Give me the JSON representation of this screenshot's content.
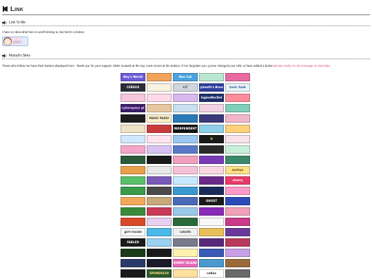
{
  "page": {
    "title_initial": "L",
    "title_rest": "INK"
  },
  "link_section": {
    "heading": "Link To Me",
    "intro": "I have no idea what here is worth linking to, but here's a button.",
    "button_text": "callus"
  },
  "mutuals_section": {
    "heading": "Mutual's Sites",
    "intro": "Those who follow me have their buttons displayed here - thank you for your support. Older mutuals at the top, most recent at the bottom. If I've forgotten you, you've changed your URL or have added a button ",
    "notify_link": "please notify me via message on Neocities."
  },
  "colors": {
    "link": "#e4477f",
    "rule": "#777777"
  },
  "buttons": [
    {
      "label": "Bey's World",
      "bg": "#6b5bd6",
      "fg": "#ffffff"
    },
    {
      "label": "",
      "bg": "#f2a35b",
      "fg": "#ffffff"
    },
    {
      "label": "Neo Cat",
      "bg": "#4aa3df",
      "fg": "#ffffff"
    },
    {
      "label": "",
      "bg": "#b9e8d0",
      "fg": "#3a7a5a"
    },
    {
      "label": "",
      "bg": "#e86aa0",
      "fg": "#ffffff"
    },
    {
      "label": "CEREUS",
      "bg": "#2d2d3a",
      "fg": "#ffffff"
    },
    {
      "label": "",
      "bg": "#f8f2e0",
      "fg": "#555555"
    },
    {
      "label": "LIT",
      "bg": "#cfd6dc",
      "fg": "#404a55"
    },
    {
      "label": "Sylmoth's Brook",
      "bg": "#2e3f9e",
      "fg": "#ffffff"
    },
    {
      "label": "tonic funk",
      "bg": "#e7f3f8",
      "fg": "#2a5a8a"
    },
    {
      "label": "",
      "bg": "#f6c6dc",
      "fg": "#a03a6a"
    },
    {
      "label": "",
      "bg": "#ffd9e8",
      "fg": "#b04a7a"
    },
    {
      "label": "",
      "bg": "#d9b8f0",
      "fg": "#6a3a9a"
    },
    {
      "label": "loginsRecDel",
      "bg": "#1f2f6a",
      "fg": "#ffffff"
    },
    {
      "label": "",
      "bg": "#ff8c9a",
      "fg": "#ffffff"
    },
    {
      "label": "cyberspace gf",
      "bg": "#3a1f6a",
      "fg": "#f3c6ff"
    },
    {
      "label": "",
      "bg": "#e8c7a0",
      "fg": "#5a3a20"
    },
    {
      "label": "",
      "bg": "#c8e0f0",
      "fg": "#2a4a6a"
    },
    {
      "label": "",
      "bg": "#f3d2e4",
      "fg": "#8a3a6a"
    },
    {
      "label": "",
      "bg": "#7fcfb9",
      "fg": "#ffffff"
    },
    {
      "label": "",
      "bg": "#1d1d1d",
      "fg": "#ff4a8a"
    },
    {
      "label": "PADEI PADEI",
      "bg": "#fff1c9",
      "fg": "#444444"
    },
    {
      "label": "",
      "bg": "#2a7ab8",
      "fg": "#ffffff"
    },
    {
      "label": "",
      "bg": "#3a3a7a",
      "fg": "#d0d0ff"
    },
    {
      "label": "",
      "bg": "#f1b7c9",
      "fg": "#7a2a4a"
    },
    {
      "label": "",
      "bg": "#efe3c6",
      "fg": "#5a4a2a"
    },
    {
      "label": "",
      "bg": "#c93b3b",
      "fg": "#ffffff"
    },
    {
      "label": "INDEPENDENT",
      "bg": "#111111",
      "fg": "#ffffff"
    },
    {
      "label": "",
      "bg": "#8fd0e8",
      "fg": "#2a4a5a"
    },
    {
      "label": "",
      "bg": "#ffd27a",
      "fg": "#6a4a1a"
    },
    {
      "label": "",
      "bg": "#d0e8ff",
      "fg": "#2a4a7a"
    },
    {
      "label": "",
      "bg": "#ffe4f0",
      "fg": "#a04a7a"
    },
    {
      "label": "",
      "bg": "#9ac8f0",
      "fg": "#1a3a5a"
    },
    {
      "label": "H",
      "bg": "#1a1a1a",
      "fg": "#f2e24a"
    },
    {
      "label": "",
      "bg": "#f8e1e8",
      "fg": "#8a3a5a"
    },
    {
      "label": "",
      "bg": "#f3a6c8",
      "fg": "#ffffff"
    },
    {
      "label": "",
      "bg": "#d7c2f4",
      "fg": "#5a3a8a"
    },
    {
      "label": "",
      "bg": "#5a7ac8",
      "fg": "#ffffff"
    },
    {
      "label": "",
      "bg": "#2a2a2a",
      "fg": "#ffffff"
    },
    {
      "label": "",
      "bg": "#c8f0d8",
      "fg": "#2a6a4a"
    },
    {
      "label": "",
      "bg": "#2a5a3a",
      "fg": "#c8ffd0"
    },
    {
      "label": "",
      "bg": "#1a1a1a",
      "fg": "#e04a4a"
    },
    {
      "label": "",
      "bg": "#f2a0c0",
      "fg": "#ffffff"
    },
    {
      "label": "",
      "bg": "#7a3ab8",
      "fg": "#ffffff"
    },
    {
      "label": "",
      "bg": "#3a8a6a",
      "fg": "#ffffff"
    },
    {
      "label": "",
      "bg": "#e8a04a",
      "fg": "#ffffff"
    },
    {
      "label": "",
      "bg": "#e8e8e8",
      "fg": "#3a3a3a"
    },
    {
      "label": "",
      "bg": "#f6c0d8",
      "fg": "#8a2a5a"
    },
    {
      "label": "",
      "bg": "#f8d8e0",
      "fg": "#8a3a4a"
    },
    {
      "label": "sanhyo",
      "bg": "#ffe08a",
      "fg": "#6a4a00"
    },
    {
      "label": "",
      "bg": "#5abf6a",
      "fg": "#ffffff"
    },
    {
      "label": "",
      "bg": "#7a5ab8",
      "fg": "#ffffff"
    },
    {
      "label": "",
      "bg": "#c8e8ff",
      "fg": "#2a4a6a"
    },
    {
      "label": "",
      "bg": "#6a2a8a",
      "fg": "#ffd0ff"
    },
    {
      "label": "cherry",
      "bg": "#e83a6a",
      "fg": "#ffffff"
    },
    {
      "label": "",
      "bg": "#3a9a4a",
      "fg": "#ffffff"
    },
    {
      "label": "",
      "bg": "#4a4a4a",
      "fg": "#ffffff"
    },
    {
      "label": "",
      "bg": "#3a9ad0",
      "fg": "#ffffff"
    },
    {
      "label": "",
      "bg": "#1a2a5a",
      "fg": "#f2e2a0"
    },
    {
      "label": "",
      "bg": "#ff9ac8",
      "fg": "#ffffff"
    },
    {
      "label": "",
      "bg": "#f2a85a",
      "fg": "#ffffff"
    },
    {
      "label": "",
      "bg": "#c8a87a",
      "fg": "#3a2a1a"
    },
    {
      "label": "",
      "bg": "#4a6ab8",
      "fg": "#ffffff"
    },
    {
      "label": "GHOST",
      "bg": "#1a1a1a",
      "fg": "#ffffff"
    },
    {
      "label": "",
      "bg": "#2a4ab8",
      "fg": "#ffffff"
    },
    {
      "label": "",
      "bg": "#3a8a3a",
      "fg": "#ffffff"
    },
    {
      "label": "",
      "bg": "#c83a5a",
      "fg": "#ffffff"
    },
    {
      "label": "",
      "bg": "#9ac8e8",
      "fg": "#1a3a5a"
    },
    {
      "label": "",
      "bg": "#8a2ab8",
      "fg": "#ffffff"
    },
    {
      "label": "",
      "bg": "#f0a0b8",
      "fg": "#6a1a3a"
    },
    {
      "label": "",
      "bg": "#d84a2a",
      "fg": "#ffffff"
    },
    {
      "label": "",
      "bg": "#e8d0f0",
      "fg": "#5a2a7a"
    },
    {
      "label": "",
      "bg": "#2a6a3a",
      "fg": "#c8ffc8"
    },
    {
      "label": "",
      "bg": "#f8f8f8",
      "fg": "#8a8a8a"
    },
    {
      "label": "",
      "bg": "#c83a8a",
      "fg": "#ffffff"
    },
    {
      "label": "girl+inside",
      "bg": "#f8f8f8",
      "fg": "#3a3a3a"
    },
    {
      "label": "",
      "bg": "#4ab8e8",
      "fg": "#ffffff"
    },
    {
      "label": "catsith",
      "bg": "#f0f0f0",
      "fg": "#3a3a3a"
    },
    {
      "label": "",
      "bg": "#e8c05a",
      "fg": "#3a2a00"
    },
    {
      "label": "",
      "bg": "#6a3a9a",
      "fg": "#ffffff"
    },
    {
      "label": "FABLED",
      "bg": "#1a1a1a",
      "fg": "#ffffff"
    },
    {
      "label": "",
      "bg": "#9ad0f0",
      "fg": "#2a4a6a"
    },
    {
      "label": "",
      "bg": "#7a7a8a",
      "fg": "#ffffff"
    },
    {
      "label": "",
      "bg": "#5a2a7a",
      "fg": "#e8c8ff"
    },
    {
      "label": "",
      "bg": "#b83a5a",
      "fg": "#ffffff"
    },
    {
      "label": "",
      "bg": "#1a3a1a",
      "fg": "#c8ffc8"
    },
    {
      "label": "",
      "bg": "#1a1a1a",
      "fg": "#ff6a3a"
    },
    {
      "label": "",
      "bg": "#fff2b0",
      "fg": "#5a4a00"
    },
    {
      "label": "",
      "bg": "#3a5ab8",
      "fg": "#ffffff"
    },
    {
      "label": "",
      "bg": "#c8a0e8",
      "fg": "#3a1a5a"
    },
    {
      "label": "",
      "bg": "#2a3a6a",
      "fg": "#ffffff"
    },
    {
      "label": "",
      "bg": "#1a1a2a",
      "fg": "#c8c8ff"
    },
    {
      "label": "BUNNY ISLAND",
      "bg": "#e86ab8",
      "fg": "#ffffff"
    },
    {
      "label": "",
      "bg": "#4a9ad0",
      "fg": "#ffffff"
    },
    {
      "label": "",
      "bg": "#9a6a3a",
      "fg": "#ffffff"
    },
    {
      "label": "",
      "bg": "#1a1a1a",
      "fg": "#ff3a3a"
    },
    {
      "label": "SPONDULIO",
      "bg": "#2a5a2a",
      "fg": "#ffe08a"
    },
    {
      "label": "",
      "bg": "#ffe0a0",
      "fg": "#7a4a00"
    },
    {
      "label": "callus",
      "bg": "#ffffff",
      "fg": "#222222"
    },
    {
      "label": "",
      "bg": "#6a6a6a",
      "fg": "#ffffff"
    }
  ]
}
